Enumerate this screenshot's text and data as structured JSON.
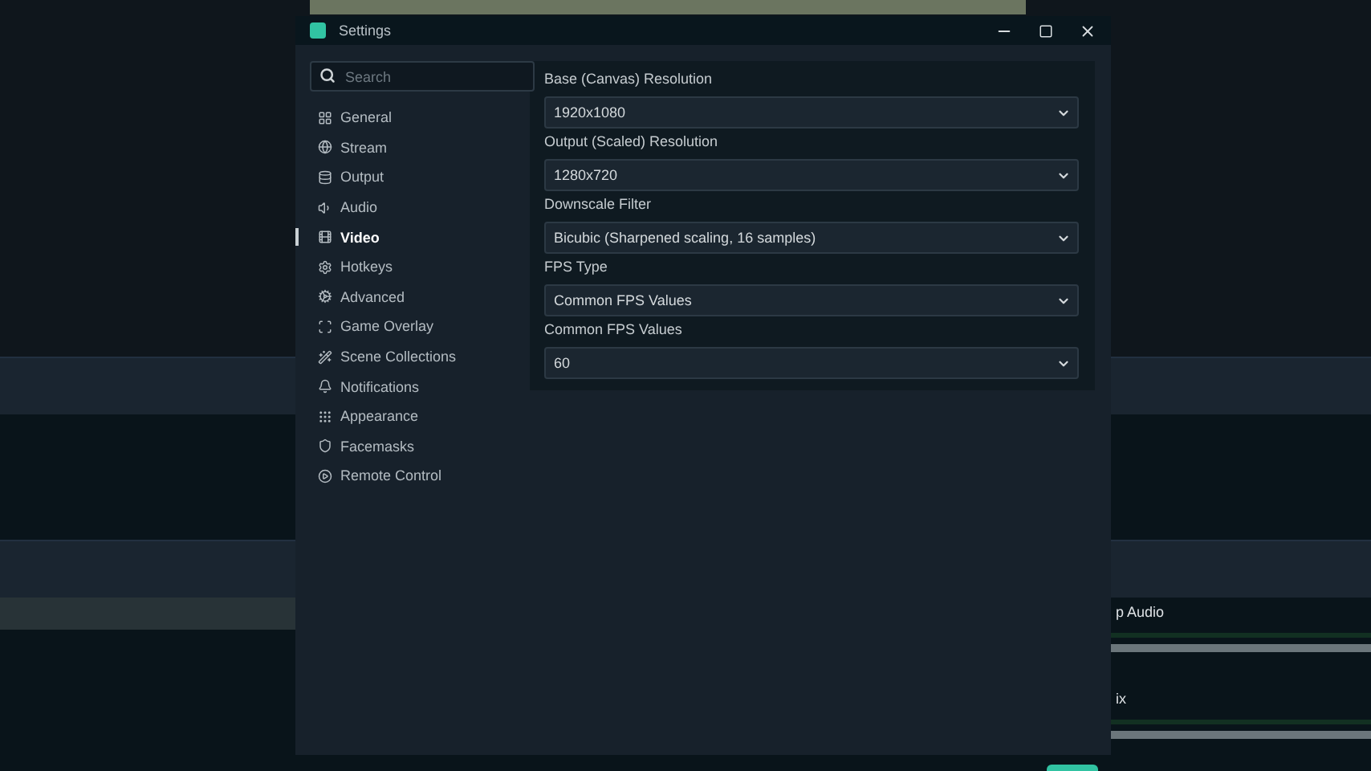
{
  "window": {
    "title": "Settings"
  },
  "search": {
    "placeholder": "Search"
  },
  "nav": [
    {
      "label": "General",
      "selected": false
    },
    {
      "label": "Stream",
      "selected": false
    },
    {
      "label": "Output",
      "selected": false
    },
    {
      "label": "Audio",
      "selected": false
    },
    {
      "label": "Video",
      "selected": true
    },
    {
      "label": "Hotkeys",
      "selected": false
    },
    {
      "label": "Advanced",
      "selected": false
    },
    {
      "label": "Game Overlay",
      "selected": false
    },
    {
      "label": "Scene Collections",
      "selected": false
    },
    {
      "label": "Notifications",
      "selected": false
    },
    {
      "label": "Appearance",
      "selected": false
    },
    {
      "label": "Facemasks",
      "selected": false
    },
    {
      "label": "Remote Control",
      "selected": false
    }
  ],
  "fields": [
    {
      "label": "Base (Canvas) Resolution",
      "value": "1920x1080"
    },
    {
      "label": "Output (Scaled) Resolution",
      "value": "1280x720"
    },
    {
      "label": "Downscale Filter",
      "value": "Bicubic (Sharpened scaling, 16 samples)"
    },
    {
      "label": "FPS Type",
      "value": "Common FPS Values"
    },
    {
      "label": "Common FPS Values",
      "value": "60"
    }
  ],
  "mixer": [
    {
      "name": "p Audio",
      "level": 1
    },
    {
      "name": "ix",
      "level": 1
    }
  ]
}
